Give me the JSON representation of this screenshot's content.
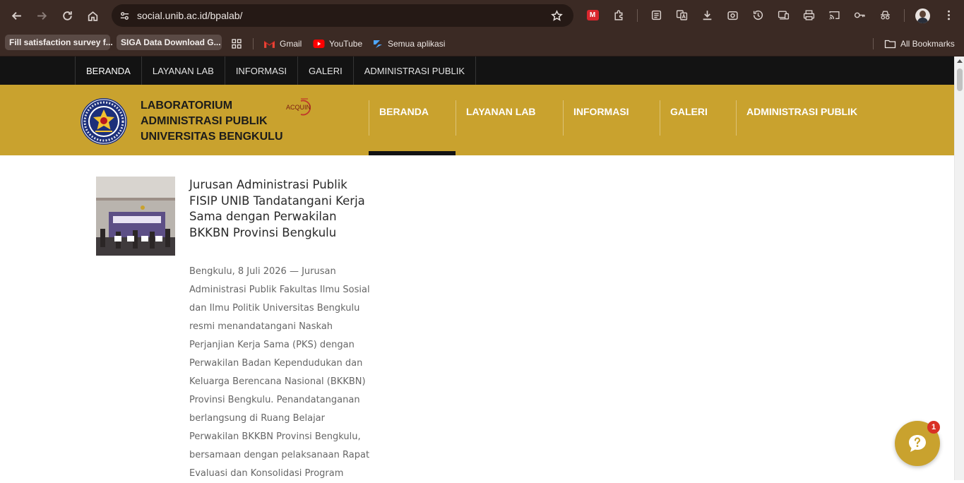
{
  "browser": {
    "url": "social.unib.ac.id/bpalab/",
    "bookmarks": [
      {
        "label": "Fill satisfaction survey f..."
      },
      {
        "label": "SIGA Data Download G..."
      },
      {
        "label": "Gmail"
      },
      {
        "label": "YouTube"
      },
      {
        "label": "Semua aplikasi"
      }
    ],
    "all_bookmarks": "All Bookmarks"
  },
  "topnav": {
    "items": [
      "BERANDA",
      "LAYANAN LAB",
      "INFORMASI",
      "GALERI",
      "ADMINISTRASI PUBLIK"
    ]
  },
  "header": {
    "brand_line1": "LABORATORIUM",
    "brand_line2": "ADMINISTRASI PUBLIK",
    "brand_line3": "UNIVERSITAS BENGKULU",
    "acquin_label": "ACQUIN",
    "brand_color": "#c9a22e"
  },
  "mainnav": {
    "items": [
      "BERANDA",
      "LAYANAN LAB",
      "INFORMASI",
      "GALERI",
      "ADMINISTRASI PUBLIK"
    ]
  },
  "article": {
    "title": "Jurusan Administrasi Publik FISIP UNIB Tandatangani Kerja Sama dengan Perwakilan BKKBN Provinsi Bengkulu",
    "body_lines": [
      "Bengkulu, 8 Juli 2026 — Jurusan",
      "Administrasi Publik Fakultas Ilmu Sosial",
      "dan Ilmu Politik Universitas Bengkulu",
      "resmi menandatangani Naskah",
      "Perjanjian Kerja Sama (PKS) dengan",
      "Perwakilan Badan Kependudukan dan",
      "Keluarga Berencana Nasional (BKKBN)",
      "Provinsi Bengkulu. Penandatanganan",
      "berlangsung di Ruang Belajar",
      "Perwakilan BKKBN Provinsi Bengkulu,",
      "bersamaan dengan pelaksanaan Rapat",
      "Evaluasi dan Konsolidasi Program"
    ]
  },
  "chat": {
    "badge_count": "1",
    "icon": "question-chat-icon"
  }
}
